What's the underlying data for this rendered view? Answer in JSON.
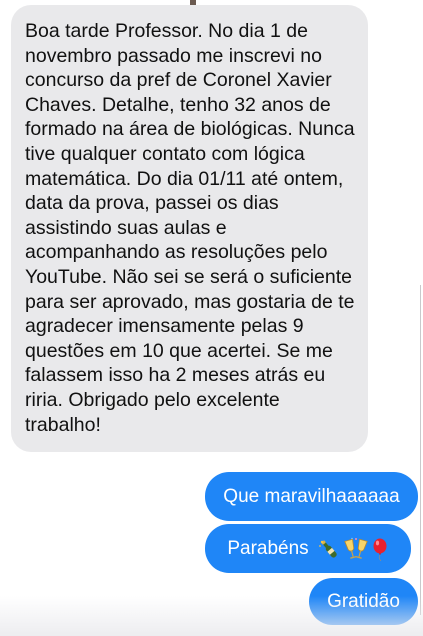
{
  "conversation": {
    "incoming": [
      {
        "text": "Boa tarde Professor. No dia 1 de novembro passado me inscrevi no concurso da pref de Coronel Xavier Chaves. Detalhe, tenho 32 anos de formado na área de biológicas. Nunca tive qualquer contato com lógica matemática. Do dia 01/11 até ontem, data da prova, passei os dias assistindo suas aulas e acompanhando as resoluções pelo YouTube. Não sei se será o suficiente para ser aprovado, mas gostaria de te agradecer imensamente pelas 9 questões em 10 que acertei. Se me falassem isso ha 2 meses atrás eu riria. Obrigado pelo excelente trabalho!"
      }
    ],
    "outgoing": [
      {
        "text": "Que maravilhaaaaaa"
      },
      {
        "text": "Parabéns",
        "emoji": [
          "champagne-bottle",
          "clinking-glasses",
          "balloon"
        ]
      },
      {
        "text": "Gratidão"
      }
    ]
  },
  "colors": {
    "incoming_bubble": "#e9e9eb",
    "outgoing_bubble": "#1f86f7",
    "incoming_text": "#111111",
    "outgoing_text": "#ffffff"
  }
}
